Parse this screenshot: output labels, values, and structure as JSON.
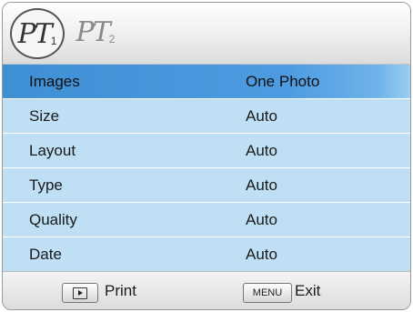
{
  "tabs": [
    {
      "glyph": "PT",
      "number": "1",
      "active": true
    },
    {
      "glyph": "PT",
      "number": "2",
      "active": false
    }
  ],
  "settings": [
    {
      "label": "Images",
      "value": "One Photo",
      "selected": true
    },
    {
      "label": "Size",
      "value": "Auto",
      "selected": false
    },
    {
      "label": "Layout",
      "value": "Auto",
      "selected": false
    },
    {
      "label": "Type",
      "value": "Auto",
      "selected": false
    },
    {
      "label": "Quality",
      "value": "Auto",
      "selected": false
    },
    {
      "label": "Date",
      "value": "Auto",
      "selected": false
    }
  ],
  "footer": {
    "play_icon": "playback-icon",
    "print_label": "Print",
    "menu_key_label": "MENU",
    "exit_label": "Exit"
  },
  "colors": {
    "row_background": "#bedff4",
    "selected_row": "#3f8fd4"
  }
}
